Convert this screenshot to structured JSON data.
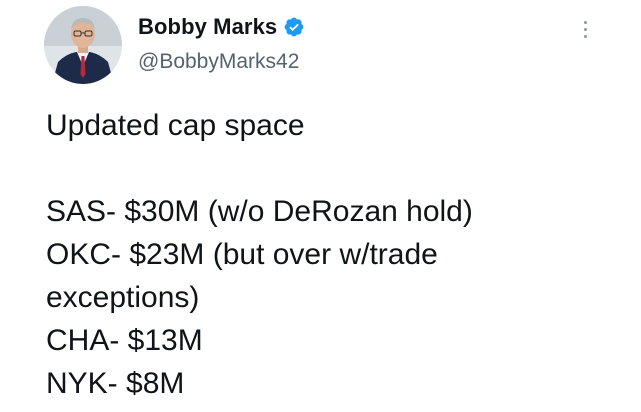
{
  "author": {
    "display_name": "Bobby Marks",
    "handle": "@BobbyMarks42",
    "verified_icon": "verified-badge-icon",
    "avatar": "profile-photo"
  },
  "menu": {
    "icon": "more-options-icon"
  },
  "tweet": {
    "heading": "Updated cap space",
    "lines": [
      "SAS- $30M (w/o DeRozan hold)",
      "OKC- $23M (but over w/trade",
      "exceptions)",
      "CHA- $13M",
      "NYK- $8M"
    ]
  },
  "colors": {
    "text": "#0f1419",
    "secondary": "#536471",
    "verified": "#1d9bf0"
  }
}
